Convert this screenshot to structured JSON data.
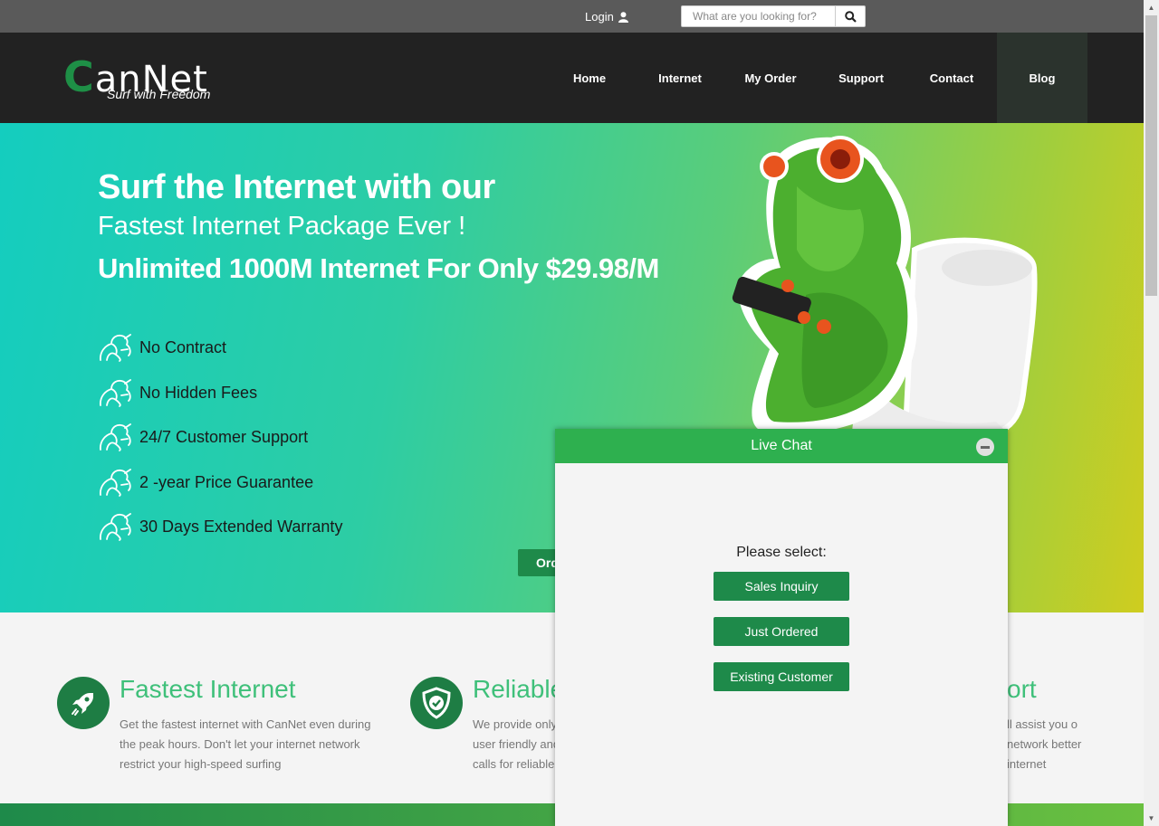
{
  "topbar": {
    "login_label": "Login",
    "search_placeholder": "What are you looking for?"
  },
  "brand": {
    "name_initial": "C",
    "name_rest": "anNet",
    "tagline": "Surf with Freedom"
  },
  "nav": {
    "items": [
      {
        "label": "Home"
      },
      {
        "label": "Internet"
      },
      {
        "label": "My Order"
      },
      {
        "label": "Support"
      },
      {
        "label": "Contact"
      },
      {
        "label": "Blog",
        "active": true
      }
    ]
  },
  "hero": {
    "headline": "Surf the Internet with our",
    "subheadline": "Fastest Internet Package Ever !",
    "offer": "Unlimited 1000M Internet For Only $29.98/M",
    "features": [
      "No Contract",
      "No Hidden Fees",
      "24/7 Customer Support",
      "2 -year Price Guarantee",
      "30 Days Extended Warranty"
    ],
    "order_button": "Ord"
  },
  "features_section": [
    {
      "title": "Fastest Internet",
      "description": "Get the fastest internet with CanNet even during the peak hours. Don't let your internet network restrict your high-speed surfing",
      "icon": "rocket-icon"
    },
    {
      "title": "Reliable",
      "description": "We provide only user friendly and calls for reliable",
      "icon": "shield-check-icon"
    },
    {
      "title": "ort",
      "description": "ll assist you o network better internet"
    }
  ],
  "live_chat": {
    "title": "Live Chat",
    "prompt": "Please select:",
    "options": [
      "Sales Inquiry",
      "Just Ordered",
      "Existing Customer"
    ]
  },
  "colors": {
    "accent_green": "#2eb04f",
    "dark_green": "#1e8a4a",
    "nav_bg": "#222222",
    "topbar_bg": "#5a5a5a",
    "feature_title": "#3fc07a"
  }
}
